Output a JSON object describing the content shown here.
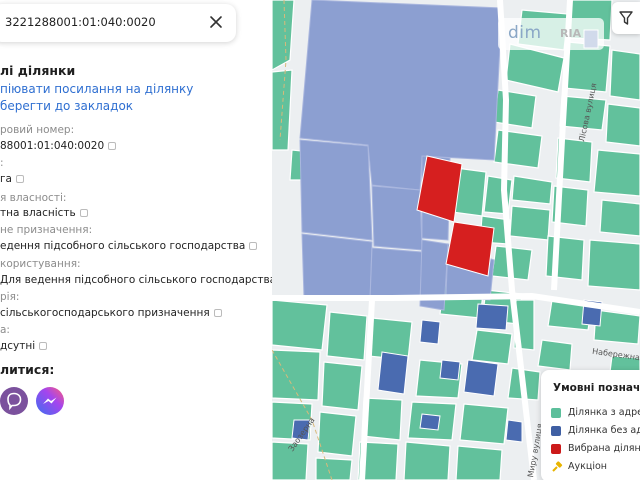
{
  "search": {
    "value": "3221288001:01:040:0020"
  },
  "panel": {
    "heading": "лі ділянки",
    "copy_link": "піювати посилання на ділянку",
    "bookmark_link": "берегти до закладок",
    "fields": [
      {
        "label": "ровий номер:",
        "value": "88001:01:040:0020"
      },
      {
        "label": ":",
        "value": "га"
      },
      {
        "label": "я власності:",
        "value": "тна власність"
      },
      {
        "label": "не призначення:",
        "value": "едення підсобного сільського господарства"
      },
      {
        "label": "користування:",
        "value": "Для ведення підсобного сільського господарства"
      },
      {
        "label": "рія:",
        "value": "сільськогосподарського призначення"
      },
      {
        "label": "а:",
        "value": "дсутні"
      }
    ],
    "share_title": "литися:"
  },
  "watermark": {
    "main": "dim",
    "sub": "RIA"
  },
  "streets": [
    "Набережна",
    "Лісова вулиця",
    "Миру вулиця",
    "Заозерна"
  ],
  "legend": {
    "title": "Умовні позначен",
    "items": [
      {
        "label": "Ділянка з адресо",
        "color": "#5cbf9b"
      },
      {
        "label": "Ділянка без адре",
        "color": "#3f5fa3"
      },
      {
        "label": "Вибрана ділянка",
        "color": "#cc1a1a"
      },
      {
        "label": "Аукціон",
        "color": "#e8b400"
      }
    ]
  },
  "colors": {
    "parcel_with_address": "#5cbf9b",
    "parcel_without_address": "#8095cc",
    "selected_parcel": "#cc1a1a",
    "link": "#2f6fd1"
  },
  "icons": [
    "close-icon",
    "viber-icon",
    "messenger-icon",
    "filter-icon",
    "auction-icon",
    "copy-icon"
  ]
}
